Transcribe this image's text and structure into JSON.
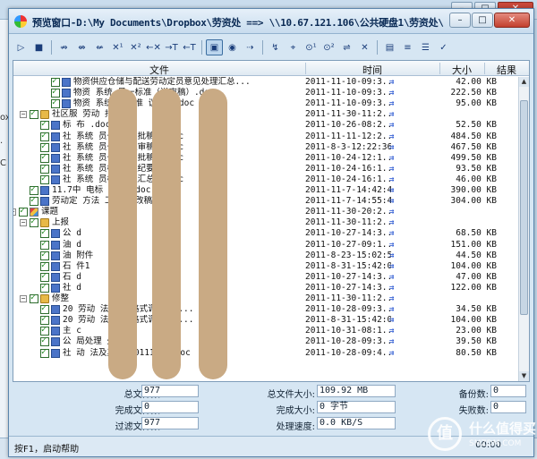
{
  "background": {
    "left_fragments": [
      {
        "text": "ox'"
      },
      {
        "text": "."
      },
      {
        "text": "C"
      }
    ],
    "window_buttons": {
      "minimize": "–",
      "restore": "□",
      "close": "✕"
    }
  },
  "window": {
    "title": "预览窗口-D:\\My Documents\\Dropbox\\劳资处 ==> \\\\10.67.121.106\\公共硬盘1\\劳资处\\",
    "buttons": {
      "minimize": "–",
      "restore": "□",
      "close": "✕"
    }
  },
  "toolbar": {
    "items": [
      {
        "glyph": "▷",
        "name": "run-icon",
        "pressed": false
      },
      {
        "glyph": "■",
        "name": "stop-icon",
        "pressed": false
      },
      {
        "glyph": "⇏",
        "name": "skip-icon",
        "pressed": false
      },
      {
        "glyph": "⇎",
        "name": "swap-icon",
        "pressed": false
      },
      {
        "glyph": "⇍",
        "name": "back-icon",
        "pressed": false
      },
      {
        "glyph": "✕¹",
        "name": "delete-one-icon",
        "pressed": false
      },
      {
        "glyph": "✕²",
        "name": "delete-two-icon",
        "pressed": false
      },
      {
        "glyph": "←✕",
        "name": "delete-left-icon",
        "pressed": false
      },
      {
        "glyph": "→T",
        "name": "copy-right-icon",
        "pressed": false
      },
      {
        "glyph": "←T",
        "name": "copy-left-icon",
        "pressed": false
      },
      {
        "glyph": "▣",
        "name": "select-all-icon",
        "pressed": true
      },
      {
        "glyph": "◉",
        "name": "preview-icon",
        "pressed": false
      },
      {
        "glyph": "⇢",
        "name": "filter-icon",
        "pressed": false
      },
      {
        "glyph": "↯",
        "name": "sync-icon",
        "pressed": false
      },
      {
        "glyph": "⌖",
        "name": "target-icon",
        "pressed": false
      },
      {
        "glyph": "⊙¹",
        "name": "option-one-icon",
        "pressed": false
      },
      {
        "glyph": "⊙²",
        "name": "option-two-icon",
        "pressed": false
      },
      {
        "glyph": "⇌",
        "name": "exchange-icon",
        "pressed": false
      },
      {
        "glyph": "✕",
        "name": "exclude-icon",
        "pressed": false
      },
      {
        "glyph": "▤",
        "name": "list-all-icon",
        "pressed": false
      },
      {
        "glyph": "≡",
        "name": "list-icon",
        "pressed": false
      },
      {
        "glyph": "☰",
        "name": "menu-icon",
        "pressed": false
      },
      {
        "glyph": "✓",
        "name": "check-icon",
        "pressed": false
      }
    ]
  },
  "list": {
    "columns": {
      "name": "文件",
      "time": "时间",
      "size": "大小",
      "result": "结果"
    },
    "rows": [
      {
        "indent": 3,
        "kind": "doc",
        "expand": "",
        "name": "物资供应仓储与配送劳动定员意见处理汇总...",
        "time": "2011-11-10-09:3...",
        "size": "42.00 KB"
      },
      {
        "indent": 3,
        "kind": "doc",
        "expand": "",
        "name": "物资 系统 员一标准（送审稿）.doc",
        "time": "2011-11-10-09:3...",
        "size": "222.50 KB"
      },
      {
        "indent": 3,
        "kind": "doc",
        "expand": "",
        "name": "物资 系统 员标准 议纪要.doc",
        "time": "2011-11-10-09:3...",
        "size": "95.00 KB"
      },
      {
        "indent": 1,
        "kind": "folder",
        "expand": "−",
        "name": "社区服 劳动 报批稿",
        "time": "2011-11-30-11:2...",
        "size": ""
      },
      {
        "indent": 2,
        "kind": "doc",
        "expand": "",
        "name": "标 布 .doc",
        "time": "2011-10-26-08:2...",
        "size": "52.50 KB"
      },
      {
        "indent": 2,
        "kind": "doc",
        "expand": "",
        "name": "社 系统 员一标 报批稿）.doc",
        "time": "2011-11-11-12:2...",
        "size": "484.50 KB"
      },
      {
        "indent": 2,
        "kind": "doc",
        "expand": "",
        "name": "社 系统 员一标 送审稿）.doc",
        "time": "2011-8-3-12:22:36",
        "size": "467.50 KB"
      },
      {
        "indent": 2,
        "kind": "doc",
        "expand": "",
        "name": "社 系统 员一编 报批稿）.doc",
        "time": "2011-10-24-12:1...",
        "size": "499.50 KB"
      },
      {
        "indent": 2,
        "kind": "doc",
        "expand": "",
        "name": "社 系统 员标准 议纪要.doc",
        "time": "2011-10-24-16:1...",
        "size": "93.50 KB"
      },
      {
        "indent": 2,
        "kind": "doc",
        "expand": "",
        "name": "社 系统 员标准 理汇总表.doc",
        "time": "2011-10-24-16:1...",
        "size": "46.00 KB"
      },
      {
        "indent": 1,
        "kind": "doc",
        "expand": "",
        "name": "11.7中 电标 求意 .doc",
        "time": "2011-11-7-14:42:42",
        "size": "390.00 KB"
      },
      {
        "indent": 1,
        "kind": "doc",
        "expand": "",
        "name": "劳动定 方法 工作 修改稿11.06）",
        "time": "2011-11-7-14:55:48",
        "size": "304.00 KB"
      },
      {
        "indent": 0,
        "kind": "fold2",
        "expand": "−",
        "name": "课题",
        "time": "2011-11-30-20:2...",
        "size": ""
      },
      {
        "indent": 1,
        "kind": "folder",
        "expand": "−",
        "name": "上报",
        "time": "2011-11-30-11:2...",
        "size": ""
      },
      {
        "indent": 2,
        "kind": "doc",
        "expand": "",
        "name": "公 d",
        "time": "2011-10-27-14:3...",
        "size": "68.50 KB"
      },
      {
        "indent": 2,
        "kind": "doc",
        "expand": "",
        "name": "油 d",
        "time": "2011-10-27-09:1...",
        "size": "151.00 KB"
      },
      {
        "indent": 2,
        "kind": "doc",
        "expand": "",
        "name": "油 附件",
        "time": "2011-8-23-15:02:52",
        "size": "44.50 KB"
      },
      {
        "indent": 2,
        "kind": "doc",
        "expand": "",
        "name": "石 件1",
        "time": "2011-8-31-15:42:06",
        "size": "104.00 KB"
      },
      {
        "indent": 2,
        "kind": "doc",
        "expand": "",
        "name": "石 d",
        "time": "2011-10-27-14:3...",
        "size": "47.00 KB"
      },
      {
        "indent": 2,
        "kind": "doc",
        "expand": "",
        "name": "社 d",
        "time": "2011-10-27-14:3...",
        "size": "122.00 KB"
      },
      {
        "indent": 1,
        "kind": "folder",
        "expand": "−",
        "name": "修整",
        "time": "2011-11-30-11:2...",
        "size": ""
      },
      {
        "indent": 2,
        "kind": "doc",
        "expand": "",
        "name": "20 劳动 法及应 格式调整-石...",
        "time": "2011-10-28-09:3...",
        "size": "34.50 KB"
      },
      {
        "indent": 2,
        "kind": "doc",
        "expand": "",
        "name": "20 劳动 法及应 格式调整-石...",
        "time": "2011-8-31-15:42:06",
        "size": "104.00 KB"
      },
      {
        "indent": 2,
        "kind": "doc",
        "expand": "",
        "name": "主 c",
        "time": "2011-10-31-08:1...",
        "size": "23.00 KB"
      },
      {
        "indent": 2,
        "kind": "doc",
        "expand": "",
        "name": "公 局处理 处理）",
        "time": "2011-10-28-09:3...",
        "size": "39.50 KB"
      },
      {
        "indent": 2,
        "kind": "doc",
        "expand": "",
        "name": "社 动 法及其 究20111027.doc",
        "time": "2011-10-28-09:4...",
        "size": "80.50 KB"
      }
    ]
  },
  "stats": {
    "total_files_label": "总文件数:",
    "total_files": "977",
    "total_size_label": "总文件大小:",
    "total_size": "109.92 MB",
    "backup_label": "备份数:",
    "backup": "0",
    "done_files_label": "完成文件数:",
    "done_files": "0",
    "done_size_label": "完成大小:",
    "done_size": "0 字节",
    "failed_label": "失败数:",
    "failed": "0",
    "filtered_label": "过滤文件数:",
    "filtered": "977",
    "speed_label": "处理速度:",
    "speed": "0.0 KB/S"
  },
  "statusbar": {
    "message": "按F1，启动帮助",
    "timer": "00:00"
  },
  "watermark": {
    "logo": "值",
    "title": "什么值得买",
    "url": "SMZDM.COM"
  },
  "colors": {
    "accent": "#2a7fc0",
    "redaction": "#c9aa84",
    "check": "#1f8a1f",
    "arrow": "#2050d0"
  }
}
